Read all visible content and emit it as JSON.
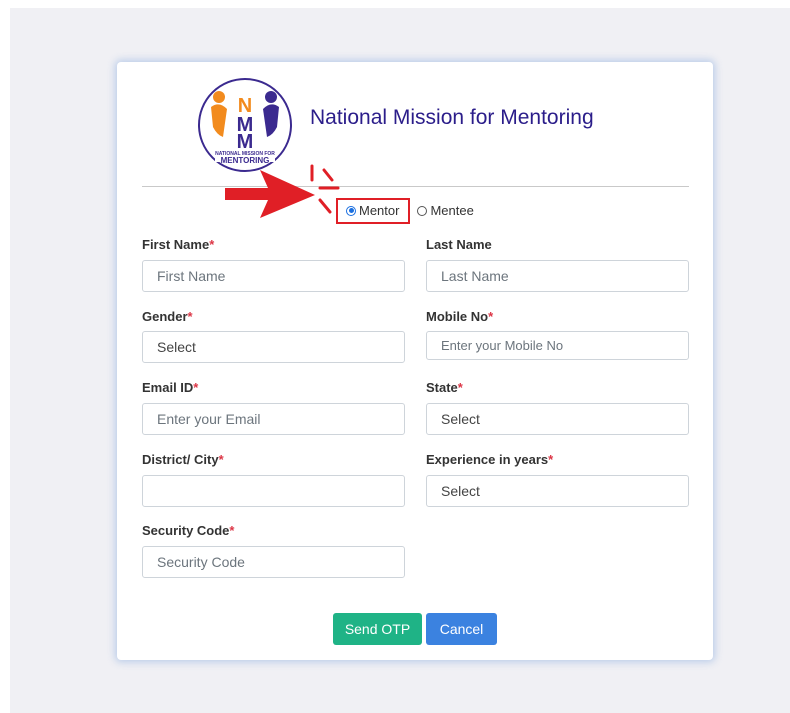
{
  "header": {
    "title": "National Mission for Mentoring",
    "logo_letters": "NMM",
    "logo_caption_line1": "NATIONAL MISSION FOR",
    "logo_caption_line2": "MENTORING"
  },
  "role": {
    "options": [
      "Mentor",
      "Mentee"
    ],
    "selected": "Mentor"
  },
  "required_mark": "*",
  "form": {
    "first_name": {
      "label": "First Name",
      "required": true,
      "placeholder": "First Name"
    },
    "last_name": {
      "label": "Last Name",
      "required": false,
      "placeholder": "Last Name"
    },
    "gender": {
      "label": "Gender",
      "required": true,
      "value": "Select"
    },
    "mobile": {
      "label": "Mobile No",
      "required": true,
      "placeholder": "Enter your Mobile No"
    },
    "email": {
      "label": "Email ID",
      "required": true,
      "placeholder": "Enter your Email"
    },
    "state": {
      "label": "State",
      "required": true,
      "value": "Select"
    },
    "district": {
      "label": "District/ City",
      "required": true,
      "value": ""
    },
    "experience": {
      "label": "Experience in years",
      "required": true,
      "value": "Select"
    },
    "security_code": {
      "label": "Security Code",
      "required": true,
      "placeholder": "Security Code"
    }
  },
  "buttons": {
    "send_otp": "Send OTP",
    "cancel": "Cancel"
  },
  "colors": {
    "title": "#2b1d8a",
    "required": "#dc3545",
    "send_otp_bg": "#1fb386",
    "cancel_bg": "#3b82e0",
    "annotation_red": "#e01f26",
    "logo_purple": "#3b2a8f",
    "logo_orange": "#f28b1e"
  },
  "annotation": {
    "icon": "red-arrow-pointer-icon"
  }
}
